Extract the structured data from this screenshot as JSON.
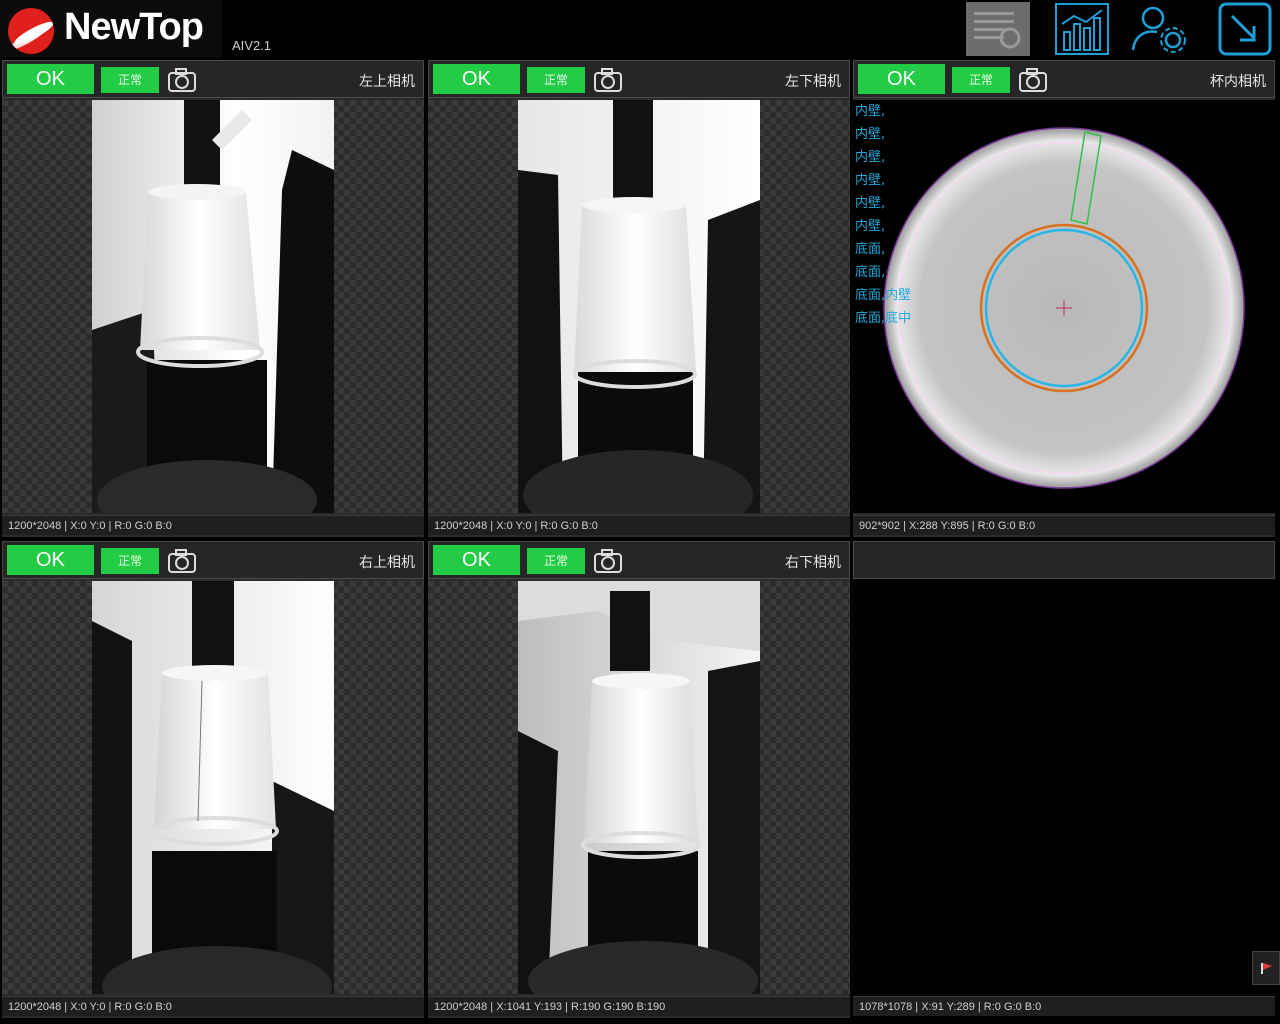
{
  "app": {
    "brand": "NewTop",
    "version": "AIV2.1"
  },
  "toolbar": {
    "buttons": [
      "list-settings",
      "statistics",
      "user-settings",
      "exit"
    ]
  },
  "panels": [
    {
      "ok": "OK",
      "status": "正常",
      "name": "左上相机",
      "info": "1200*2048 | X:0 Y:0 | R:0 G:0 B:0"
    },
    {
      "ok": "OK",
      "status": "正常",
      "name": "左下相机",
      "info": "1200*2048 | X:0 Y:0 | R:0 G:0 B:0"
    },
    {
      "ok": "OK",
      "status": "正常",
      "name": "杯内相机",
      "info": "902*902 | X:288 Y:895 | R:0 G:0 B:0"
    },
    {
      "ok": "OK",
      "status": "正常",
      "name": "右上相机",
      "info": "1200*2048 | X:0 Y:0 | R:0 G:0 B:0"
    },
    {
      "ok": "OK",
      "status": "正常",
      "name": "右下相机",
      "info": "1200*2048 | X:1041 Y:193 | R:190 G:190 B:190"
    },
    {
      "info": "1078*1078 | X:91 Y:289 | R:0 G:0 B:0"
    }
  ],
  "inner_overlay": [
    "内壁,",
    "内壁,",
    "内壁,",
    "内壁,",
    "内壁,",
    "内壁,",
    "底面,",
    "底面,",
    "底面,内壁",
    "底面,底中"
  ],
  "colors": {
    "ok_green": "#22cc44",
    "accent_blue": "#1e9fd8",
    "overlay_cyan": "#21a9d9"
  }
}
